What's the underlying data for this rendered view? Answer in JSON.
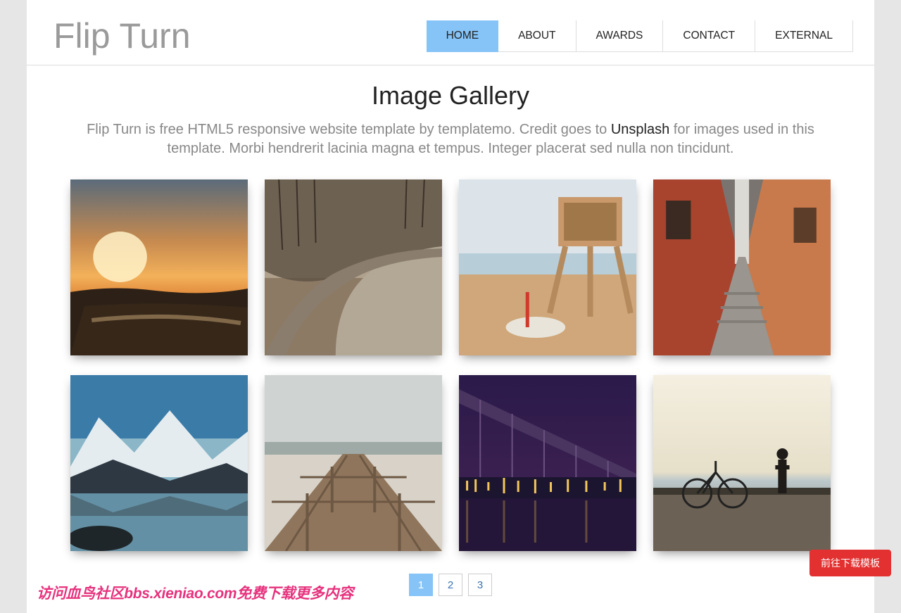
{
  "header": {
    "logo": "Flip Turn",
    "nav": [
      {
        "label": "HOME",
        "active": true
      },
      {
        "label": "ABOUT",
        "active": false
      },
      {
        "label": "AWARDS",
        "active": false
      },
      {
        "label": "CONTACT",
        "active": false
      },
      {
        "label": "EXTERNAL",
        "active": false
      }
    ]
  },
  "gallery": {
    "title": "Image Gallery",
    "desc_pre": "Flip Turn is free HTML5 responsive website template by templatemo. Credit goes to ",
    "desc_link": "Unsplash",
    "desc_post": " for images used in this template. Morbi hendrerit lacinia magna et tempus. Integer placerat sed nulla non tincidunt.",
    "images": [
      {
        "name": "sunset-beach"
      },
      {
        "name": "forest-road"
      },
      {
        "name": "lifeguard-beach"
      },
      {
        "name": "narrow-alley"
      },
      {
        "name": "mountain-lake"
      },
      {
        "name": "wooden-pier"
      },
      {
        "name": "city-bridge-night"
      },
      {
        "name": "man-bike-dock"
      }
    ],
    "pages": [
      {
        "label": "1",
        "active": true
      },
      {
        "label": "2",
        "active": false
      },
      {
        "label": "3",
        "active": false
      }
    ]
  },
  "overlay": {
    "download_button": "前往下载模板",
    "watermark": "访问血鸟社区bbs.xieniao.com免费下载更多内容"
  }
}
